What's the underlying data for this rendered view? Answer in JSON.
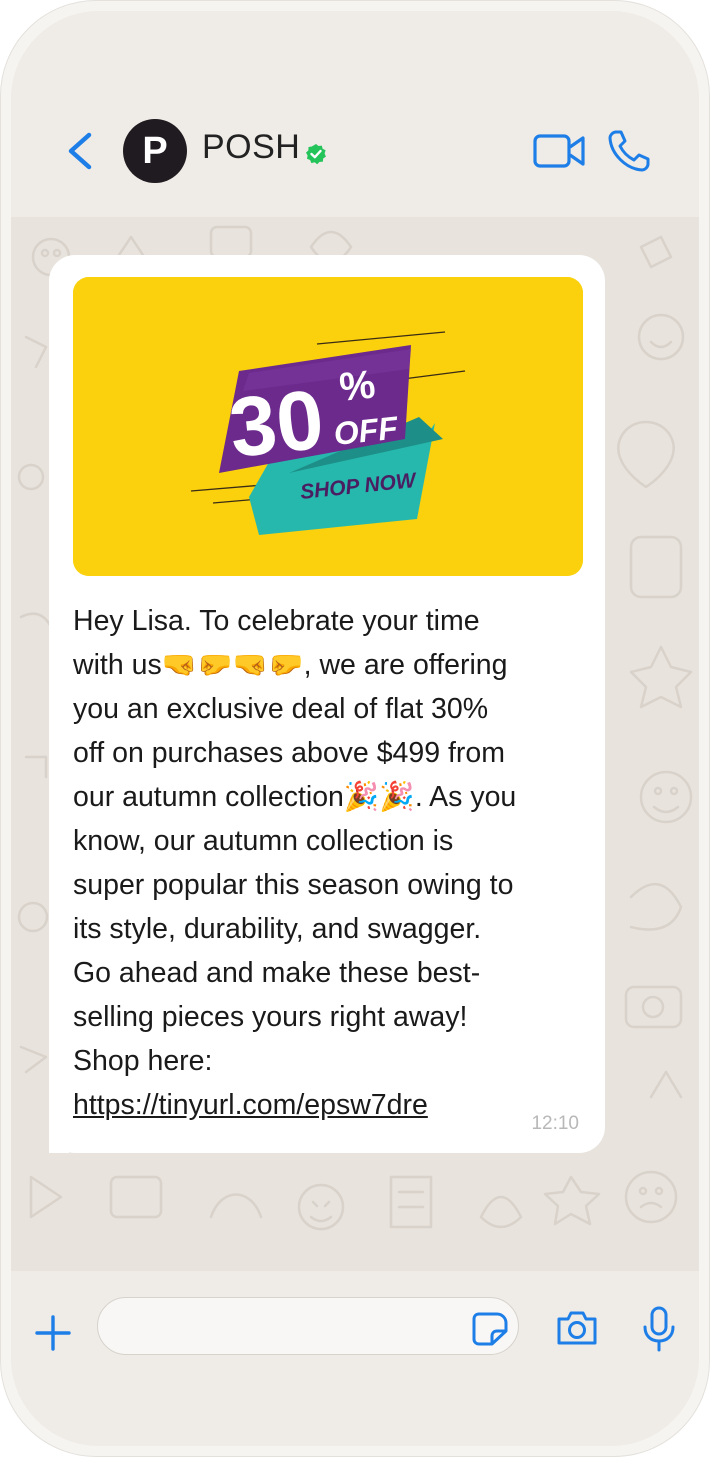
{
  "header": {
    "avatar_letter": "P",
    "contact_name": "POSH",
    "verified": true
  },
  "promo": {
    "discount_number": "30",
    "percent_sign": "%",
    "off_text": "OFF",
    "cta_text": "SHOP NOW"
  },
  "message": {
    "text": "Hey Lisa. To celebrate your time\nwith us🤜🤛🤜🤛, we are offering\nyou an exclusive deal of flat 30%\noff on purchases above $499 from\nour autumn collection🎉🎉. As you\nknow, our autumn collection is\nsuper popular this season owing to\nits style, durability, and swagger.\nGo ahead and make these best-\nselling pieces yours right away!\nShop here:",
    "link": "https://tinyurl.com/epsw7dre",
    "time": "12:10"
  },
  "input": {
    "placeholder": ""
  },
  "colors": {
    "accent": "#1d7ee8",
    "verified": "#25c45a",
    "promo_yellow": "#fad10c",
    "promo_purple": "#6b2a8c",
    "promo_teal": "#27b8ad"
  }
}
